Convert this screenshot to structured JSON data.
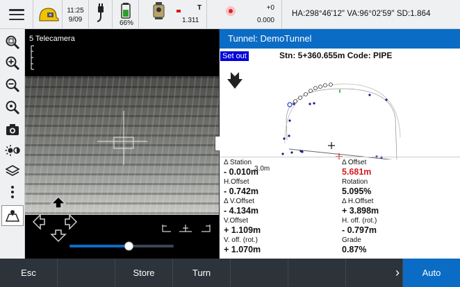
{
  "statusbar": {
    "time": "11:25",
    "date": "9/09",
    "battery_pct": "66%",
    "battery_level": 0.66,
    "instrument_target": "T",
    "instrument_value": "1.311",
    "prism_value1": "+0",
    "prism_value2": "0.000",
    "angles": "HA:298°46'12\"  VA:96°02'59\"  SD:1.864"
  },
  "video": {
    "title": "5 Telecamera",
    "zoom_slider_fraction": 0.57
  },
  "panel": {
    "title": "Tunnel: DemoTunnel",
    "setout_label": "Set out",
    "station_text": "Stn: 5+360.655m   Code: PIPE",
    "scale_label": "3.0m",
    "offsets": [
      {
        "label": "Δ Station",
        "value": "- 0.010m"
      },
      {
        "label": "Δ Offset",
        "value": "5.681m",
        "color": "#d8191c"
      },
      {
        "label": "H.Offset",
        "value": "- 0.742m"
      },
      {
        "label": "Rotation",
        "value": "5.095%"
      },
      {
        "label": "Δ V.Offset",
        "value": "- 4.134m"
      },
      {
        "label": "Δ H.Offset",
        "value": "+ 3.898m"
      },
      {
        "label": "V.Offset",
        "value": "+ 1.109m"
      },
      {
        "label": "H. off. (rot.)",
        "value": "- 0.797m"
      },
      {
        "label": "V. off. (rot.)",
        "value": "+ 1.070m"
      },
      {
        "label": "Grade",
        "value": "0.87%"
      }
    ]
  },
  "bottombar": {
    "esc": "Esc",
    "store": "Store",
    "turn": "Turn",
    "more": "›",
    "auto": "Auto"
  },
  "colors": {
    "accent_blue": "#0b6cc5",
    "setout_blue": "#0000d8",
    "alert_red": "#d8191c",
    "bottom_bar": "#2d333b"
  }
}
